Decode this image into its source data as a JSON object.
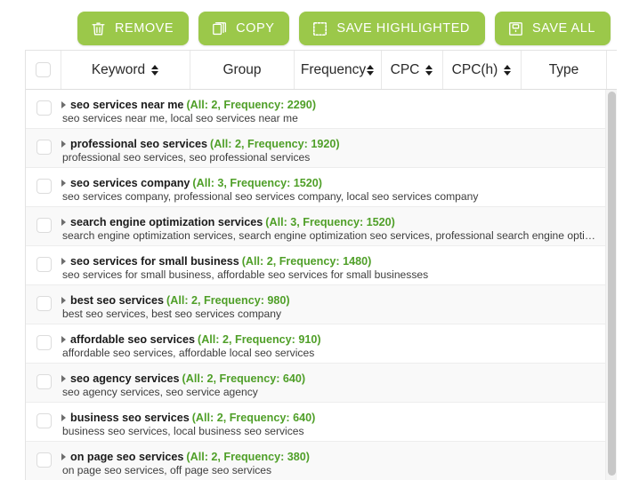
{
  "toolbar": {
    "buttons": [
      {
        "label": "REMOVE",
        "icon": "trash-icon",
        "name": "remove-button"
      },
      {
        "label": "COPY",
        "icon": "copy-icon",
        "name": "copy-button"
      },
      {
        "label": "SAVE HIGHLIGHTED",
        "icon": "dashed-square-icon",
        "name": "save-highlighted-button"
      },
      {
        "label": "SAVE ALL",
        "icon": "save-disk-icon",
        "name": "save-all-button"
      }
    ],
    "accent_color": "#9bc84a",
    "label_color": "#ffffff"
  },
  "table": {
    "select_all_checked": false,
    "columns": [
      {
        "label": "Keyword",
        "sortable": true
      },
      {
        "label": "Group",
        "sortable": false
      },
      {
        "label": "Frequency",
        "sortable": true
      },
      {
        "label": "CPC",
        "sortable": true
      },
      {
        "label": "CPC(h)",
        "sortable": true
      },
      {
        "label": "Type",
        "sortable": false
      }
    ],
    "stats_color": "#4f9f28",
    "rows": [
      {
        "checked": false,
        "keyword": "seo services near me",
        "stats": "(All: 2, Frequency: 2290)",
        "all": 2,
        "frequency": 2290,
        "subkeywords": "seo services near me, local seo services near me",
        "truncated": false
      },
      {
        "checked": false,
        "keyword": "professional seo services",
        "stats": "(All: 2, Frequency: 1920)",
        "all": 2,
        "frequency": 1920,
        "subkeywords": "professional seo services, seo professional services",
        "truncated": false
      },
      {
        "checked": false,
        "keyword": "seo services company",
        "stats": "(All: 3, Frequency: 1520)",
        "all": 3,
        "frequency": 1520,
        "subkeywords": "seo services company, professional seo services company, local seo services company",
        "truncated": false
      },
      {
        "checked": false,
        "keyword": "search engine optimization services",
        "stats": "(All: 3, Frequency: 1520)",
        "all": 3,
        "frequency": 1520,
        "subkeywords": "search engine optimization services, search engine optimization seo services, professional search engine optimi…",
        "truncated": true
      },
      {
        "checked": false,
        "keyword": "seo services for small business",
        "stats": "(All: 2, Frequency: 1480)",
        "all": 2,
        "frequency": 1480,
        "subkeywords": "seo services for small business, affordable seo services for small businesses",
        "truncated": false
      },
      {
        "checked": false,
        "keyword": "best seo services",
        "stats": "(All: 2, Frequency: 980)",
        "all": 2,
        "frequency": 980,
        "subkeywords": "best seo services, best seo services company",
        "truncated": false
      },
      {
        "checked": false,
        "keyword": "affordable seo services",
        "stats": "(All: 2, Frequency: 910)",
        "all": 2,
        "frequency": 910,
        "subkeywords": "affordable seo services, affordable local seo services",
        "truncated": false
      },
      {
        "checked": false,
        "keyword": "seo agency services",
        "stats": "(All: 2, Frequency: 640)",
        "all": 2,
        "frequency": 640,
        "subkeywords": "seo agency services, seo service agency",
        "truncated": false
      },
      {
        "checked": false,
        "keyword": "business seo services",
        "stats": "(All: 2, Frequency: 640)",
        "all": 2,
        "frequency": 640,
        "subkeywords": "business seo services, local business seo services",
        "truncated": false
      },
      {
        "checked": false,
        "keyword": "on page seo services",
        "stats": "(All: 2, Frequency: 380)",
        "all": 2,
        "frequency": 380,
        "subkeywords": "on page seo services, off page seo services",
        "truncated": false
      }
    ]
  }
}
